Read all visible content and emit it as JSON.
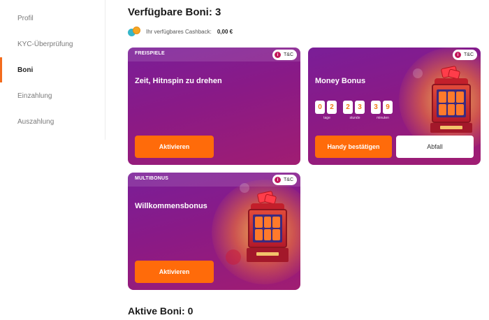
{
  "sidebar": {
    "items": [
      {
        "label": "Profil",
        "active": false
      },
      {
        "label": "KYC-Überprüfung",
        "active": false
      },
      {
        "label": "Boni",
        "active": true
      },
      {
        "label": "Einzahlung",
        "active": false
      },
      {
        "label": "Auszahlung",
        "active": false
      }
    ]
  },
  "header": {
    "title": "Verfügbare Boni: 3",
    "cashback_label": "Ihr verfügbares Cashback:",
    "cashback_value": "0,00 €"
  },
  "cards": [
    {
      "tag": "FREISPIELE",
      "tc": "T&C",
      "title": "Zeit, Hitnspin zu drehen",
      "primary_button": "Aktivieren"
    },
    {
      "tag": "",
      "tc": "T&C",
      "title": "Money Bonus",
      "countdown": {
        "days": [
          "0",
          "2"
        ],
        "hours": [
          "2",
          "3"
        ],
        "minutes": [
          "3",
          "9"
        ],
        "labels": {
          "days": "tage",
          "hours": "stunde",
          "minutes": "minuten"
        }
      },
      "primary_button": "Handy bestätigen",
      "secondary_button": "Abfall"
    },
    {
      "tag": "MULTIBONUS",
      "tc": "T&C",
      "title": "Willkommensbonus",
      "primary_button": "Aktivieren"
    }
  ],
  "active": {
    "title": "Aktive Boni: 0"
  },
  "colors": {
    "accent_orange": "#ff6b0a",
    "card_purple": "#7a1e98",
    "card_magenta": "#a01d72",
    "sidebar_active_bar": "#f36c1d"
  },
  "icons": {
    "cashback": "coins-icon",
    "tc_info": "info-icon"
  }
}
